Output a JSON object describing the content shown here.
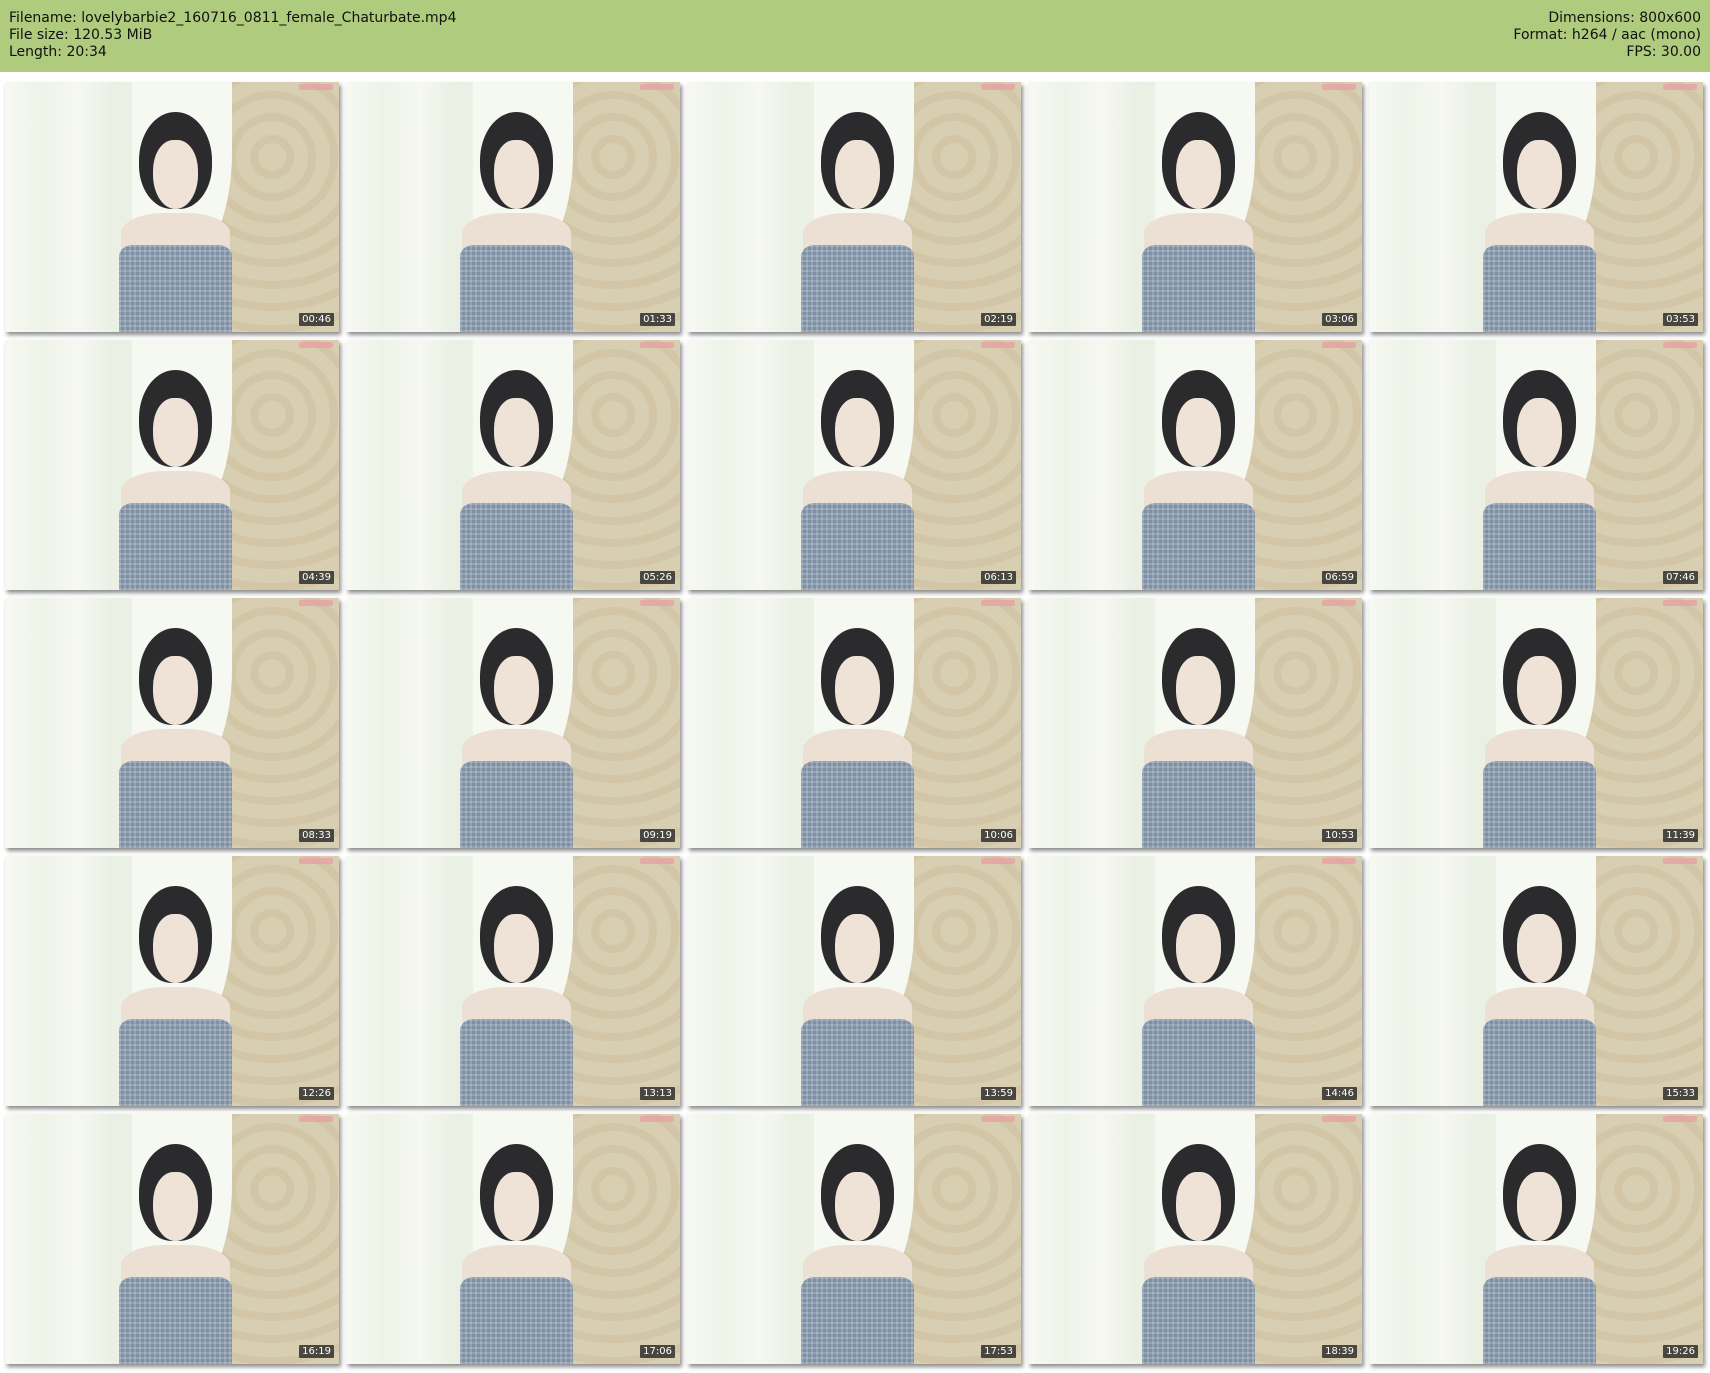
{
  "header": {
    "filename": "Filename: lovelybarbie2_160716_0811_female_Chaturbate.mp4",
    "filesize": "File size: 120.53 MiB",
    "length": "Length: 20:34",
    "dimensions": "Dimensions: 800x600",
    "format": "Format: h264 / aac (mono)",
    "fps": "FPS: 30.00"
  },
  "thumbnails": [
    {
      "time": "00:46"
    },
    {
      "time": "01:33"
    },
    {
      "time": "02:19"
    },
    {
      "time": "03:06"
    },
    {
      "time": "03:53"
    },
    {
      "time": "04:39"
    },
    {
      "time": "05:26"
    },
    {
      "time": "06:13"
    },
    {
      "time": "06:59"
    },
    {
      "time": "07:46"
    },
    {
      "time": "08:33"
    },
    {
      "time": "09:19"
    },
    {
      "time": "10:06"
    },
    {
      "time": "10:53"
    },
    {
      "time": "11:39"
    },
    {
      "time": "12:26"
    },
    {
      "time": "13:13"
    },
    {
      "time": "13:59"
    },
    {
      "time": "14:46"
    },
    {
      "time": "15:33"
    },
    {
      "time": "16:19"
    },
    {
      "time": "17:06"
    },
    {
      "time": "17:53"
    },
    {
      "time": "18:39"
    },
    {
      "time": "19:26"
    }
  ],
  "colors": {
    "header_bg": "#afcb7e",
    "timestamp_bg": "#282828",
    "page_bg": "#ffffff"
  }
}
